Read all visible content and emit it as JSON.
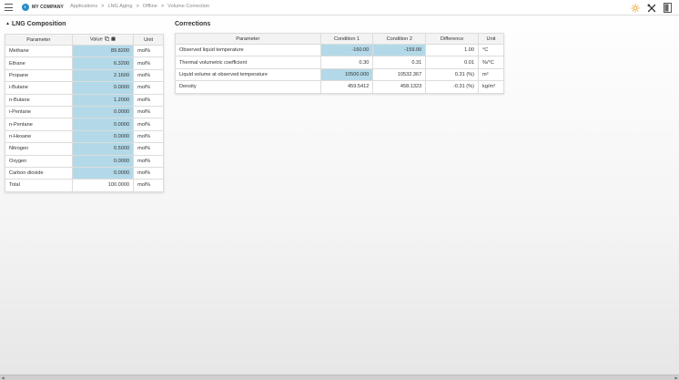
{
  "topbar": {
    "company": "MY COMPANY",
    "breadcrumb": [
      "Applications",
      "LNG Aging",
      "Offline",
      "Volume Correction"
    ]
  },
  "composition": {
    "title": "LNG Composition",
    "headers": {
      "parameter": "Parameter",
      "value": "Value",
      "unit": "Unit"
    },
    "rows": [
      {
        "parameter": "Methane",
        "value": "89.8200",
        "unit": "mol%"
      },
      {
        "parameter": "Ethane",
        "value": "6.3200",
        "unit": "mol%"
      },
      {
        "parameter": "Propane",
        "value": "2.1600",
        "unit": "mol%"
      },
      {
        "parameter": "i-Butane",
        "value": "0.0000",
        "unit": "mol%"
      },
      {
        "parameter": "n-Butane",
        "value": "1.2000",
        "unit": "mol%"
      },
      {
        "parameter": "i-Pentane",
        "value": "0.0000",
        "unit": "mol%"
      },
      {
        "parameter": "n-Pentane",
        "value": "0.0000",
        "unit": "mol%"
      },
      {
        "parameter": "n-Hexane",
        "value": "0.0000",
        "unit": "mol%"
      },
      {
        "parameter": "Nitrogen",
        "value": "0.5000",
        "unit": "mol%"
      },
      {
        "parameter": "Oxygen",
        "value": "0.0000",
        "unit": "mol%"
      },
      {
        "parameter": "Carbon dioxide",
        "value": "0.0000",
        "unit": "mol%"
      }
    ],
    "total": {
      "parameter": "Total",
      "value": "100.0000",
      "unit": "mol%"
    }
  },
  "corrections": {
    "title": "Corrections",
    "headers": {
      "parameter": "Parameter",
      "cond1": "Condition 1",
      "cond2": "Condition 2",
      "difference": "Difference",
      "unit": "Unit"
    },
    "rows": [
      {
        "parameter": "Observed liquid temperature",
        "cond1": "-160.00",
        "cond2": "-159.00",
        "difference": "1.00",
        "unit": "°C"
      },
      {
        "parameter": "Thermal volumetric coefficient",
        "cond1": "0.30",
        "cond2": "0.31",
        "difference": "0.01",
        "unit": "%/°C"
      },
      {
        "parameter": "Liquid volume at observed temperature",
        "cond1": "10500.000",
        "cond2": "10532.367",
        "difference": "0.31 (%)",
        "unit": "m³"
      },
      {
        "parameter": "Density",
        "cond1": "459.5412",
        "cond2": "458.1323",
        "difference": "-0.31 (%)",
        "unit": "kg/m³"
      }
    ]
  },
  "colors": {
    "accent": "#2a8fc6",
    "editable_cell": "#b3d9e8",
    "sun_icon": "#f0a030"
  }
}
